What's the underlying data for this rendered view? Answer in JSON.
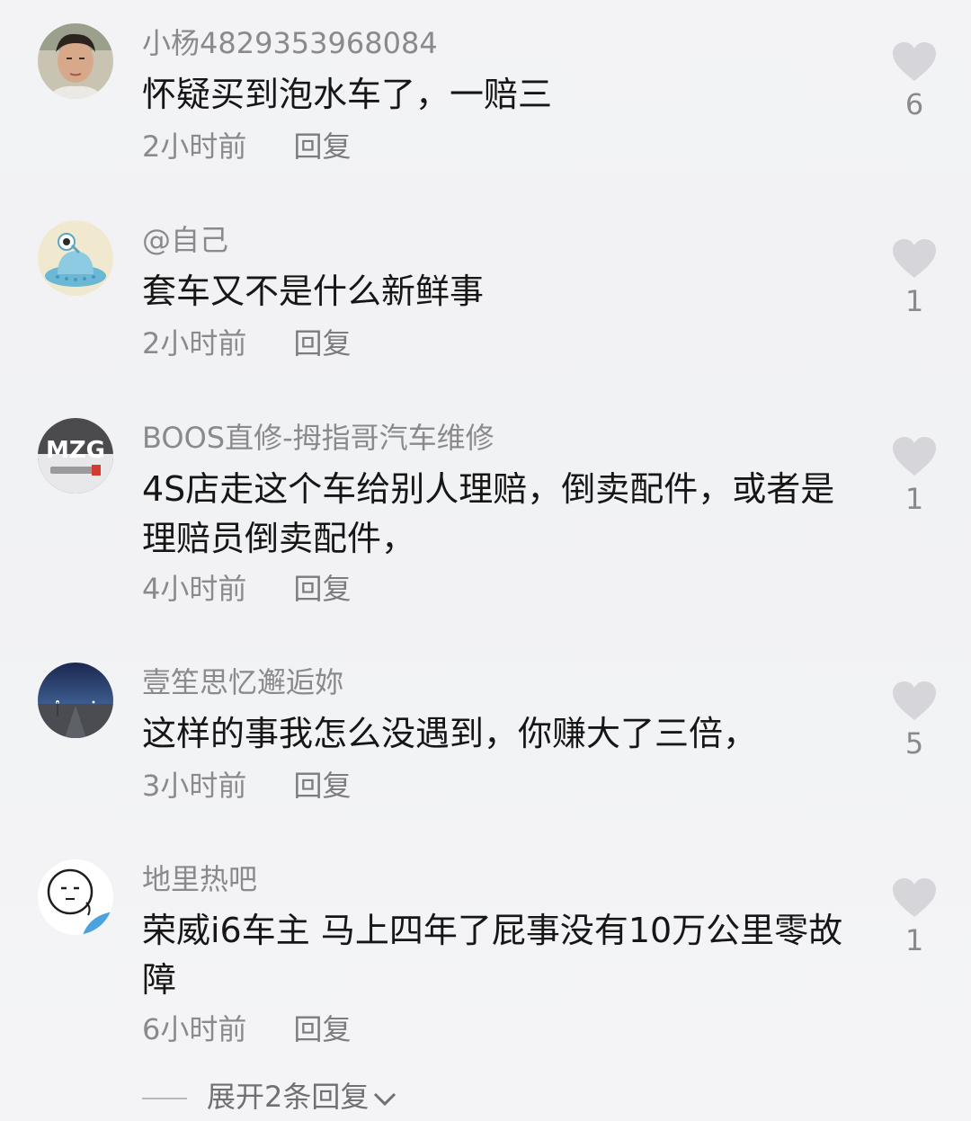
{
  "comments": [
    {
      "username": "小杨4829353968084",
      "text": "怀疑买到泡水车了，一赔三",
      "time": "2小时前",
      "reply": "回复",
      "likes": "6",
      "avatar_icon": "person-photo-avatar"
    },
    {
      "username": "@自己",
      "text": "套车又不是什么新鲜事",
      "time": "2小时前",
      "reply": "回复",
      "likes": "1",
      "avatar_icon": "alien-ufo-avatar"
    },
    {
      "username": "BOOS直修-拇指哥汽车维修",
      "text": "4S店走这个车给别人理赔，倒卖配件，或者是理赔员倒卖配件，",
      "time": "4小时前",
      "reply": "回复",
      "likes": "1",
      "avatar_icon": "mzg-logo-avatar",
      "avatar_text": "MZG"
    },
    {
      "username": "壹笙思忆邂逅妳",
      "text": "这样的事我怎么没遇到，你赚大了三倍，",
      "time": "3小时前",
      "reply": "回复",
      "likes": "5",
      "avatar_icon": "night-road-avatar"
    },
    {
      "username": "地里热吧",
      "text": "荣威i6车主 马上四年了屁事没有10万公里零故障",
      "time": "6小时前",
      "reply": "回复",
      "likes": "1",
      "avatar_icon": "cartoon-face-avatar"
    }
  ],
  "expand_replies": "展开2条回复",
  "colors": {
    "background": "#f2f2f4",
    "text": "#161616",
    "muted": "#8a8a8e",
    "heart": "#d6d6da"
  }
}
